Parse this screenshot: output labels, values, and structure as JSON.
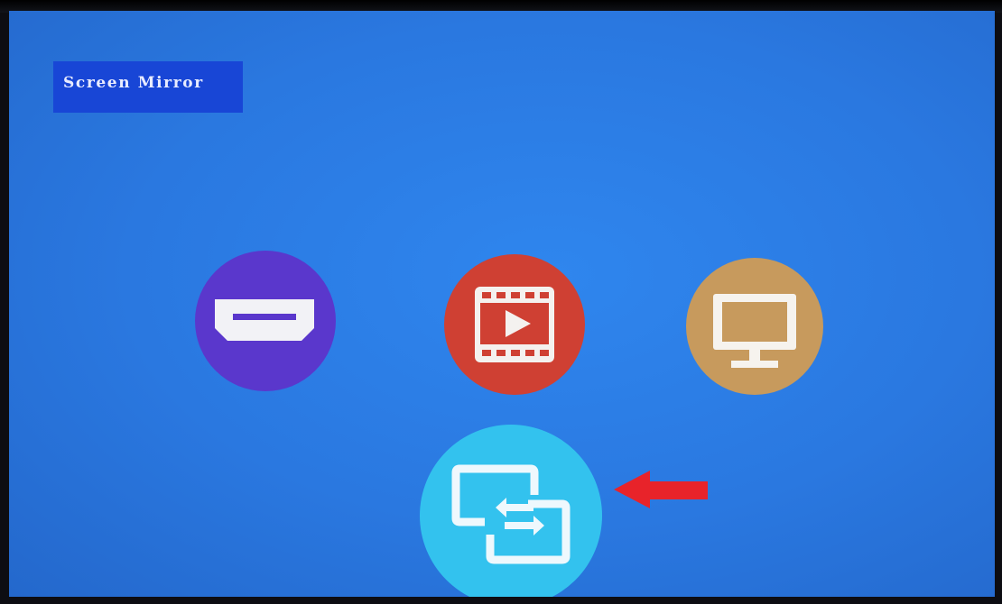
{
  "header": {
    "title": "Screen Mirror"
  },
  "menu": {
    "items": [
      {
        "name": "hdmi",
        "icon": "hdmi-icon",
        "color": "#5a37cc"
      },
      {
        "name": "video",
        "icon": "film-play-icon",
        "color": "#cf4033"
      },
      {
        "name": "pc",
        "icon": "monitor-icon",
        "color": "#c79a5d"
      },
      {
        "name": "screen-mirror",
        "icon": "screen-mirror-icon",
        "color": "#33c2ee",
        "selected": true
      }
    ]
  },
  "annotation": {
    "icon": "red-arrow-left",
    "color": "#e8232a"
  }
}
